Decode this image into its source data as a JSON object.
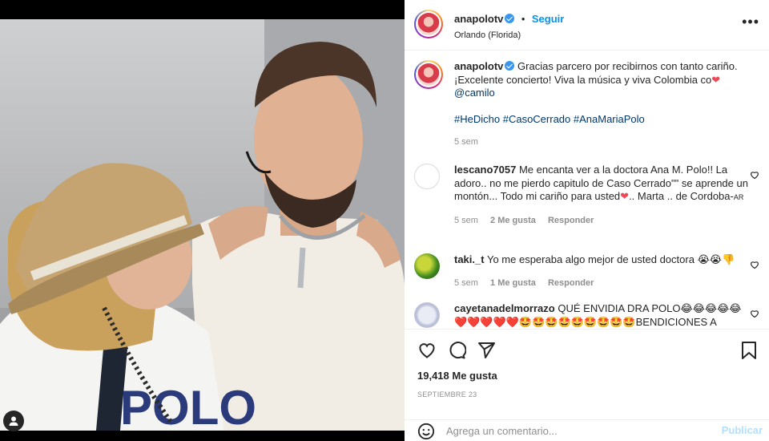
{
  "post": {
    "username": "anapolotv",
    "follow_label": "Seguir",
    "separator": "•",
    "location": "Orlando (Florida)",
    "more_label": "•••"
  },
  "caption": {
    "username": "anapolotv",
    "text": "Gracias parcero por recibirnos con tanto cariño. ¡Excelente concierto! Viva la música y viva Colombia co",
    "mention": "@camilo",
    "hashtags": [
      "#HeDicho",
      "#CasoCerrado",
      "#AnaMariaPolo"
    ],
    "time": "5 sem"
  },
  "comments": [
    {
      "username": "lescano7057",
      "text": "Me encanta ver a la doctora Ana M. Polo!! La adoro.. no me pierdo capitulo de Caso Cerrado\"\" se aprende un montón... Todo mi cariño para usted",
      "text_tail": ".. Marta .. de Cordoba-",
      "tag": "AR",
      "time": "5 sem",
      "likes": "2 Me gusta",
      "reply": "Responder"
    },
    {
      "username": "taki._t",
      "text": "Yo me esperaba algo mejor de usted doctora",
      "emojis": "😭😭👎",
      "time": "5 sem",
      "likes": "1 Me gusta",
      "reply": "Responder"
    },
    {
      "username": "cayetanadelmorrazo",
      "text": "QUÉ ENVIDIA DRA POLO",
      "emojis_line1": "😂😂😂😂😂",
      "emojis_line2": "❤️❤️❤️❤️❤️🤩🤩🤩🤩🤩🤩🤩🤩🤩",
      "text_tail": "BENDICIONES A"
    }
  ],
  "actions": {
    "likes_count": "19,418 Me gusta",
    "date": "SEPTIEMBRE 23",
    "comment_placeholder": "Agrega un comentario...",
    "publish_label": "Publicar"
  },
  "colors": {
    "accent": "#0095f6",
    "verified": "#3897f0",
    "heart": "#ed4956",
    "muted": "#8e8e8e"
  },
  "icons": [
    "user-tag-icon",
    "verified-icon",
    "more-icon",
    "heart-icon",
    "comment-icon",
    "share-icon",
    "bookmark-icon",
    "emoji-icon"
  ]
}
